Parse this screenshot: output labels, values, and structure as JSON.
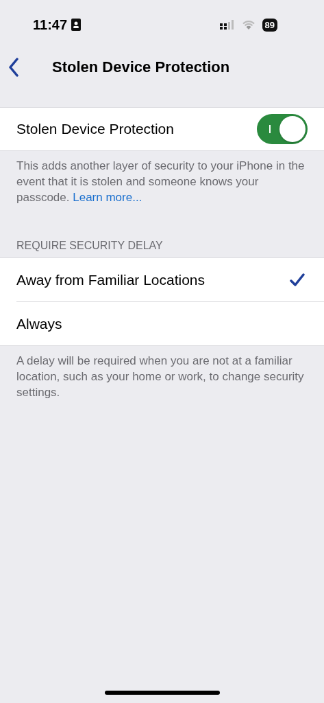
{
  "status_bar": {
    "time": "11:47",
    "battery": "89"
  },
  "nav": {
    "title": "Stolen Device Protection"
  },
  "toggle_row": {
    "label": "Stolen Device Protection",
    "on": true
  },
  "toggle_footer": {
    "text": "This adds another layer of security to your iPhone in the event that it is stolen and someone knows your passcode.",
    "link": "Learn more..."
  },
  "delay_section": {
    "header": "REQUIRE SECURITY DELAY",
    "options": [
      {
        "label": "Away from Familiar Locations",
        "selected": true
      },
      {
        "label": "Always",
        "selected": false
      }
    ],
    "footer": "A delay will be required when you are not at a familiar location, such as your home or work, to change security settings."
  }
}
